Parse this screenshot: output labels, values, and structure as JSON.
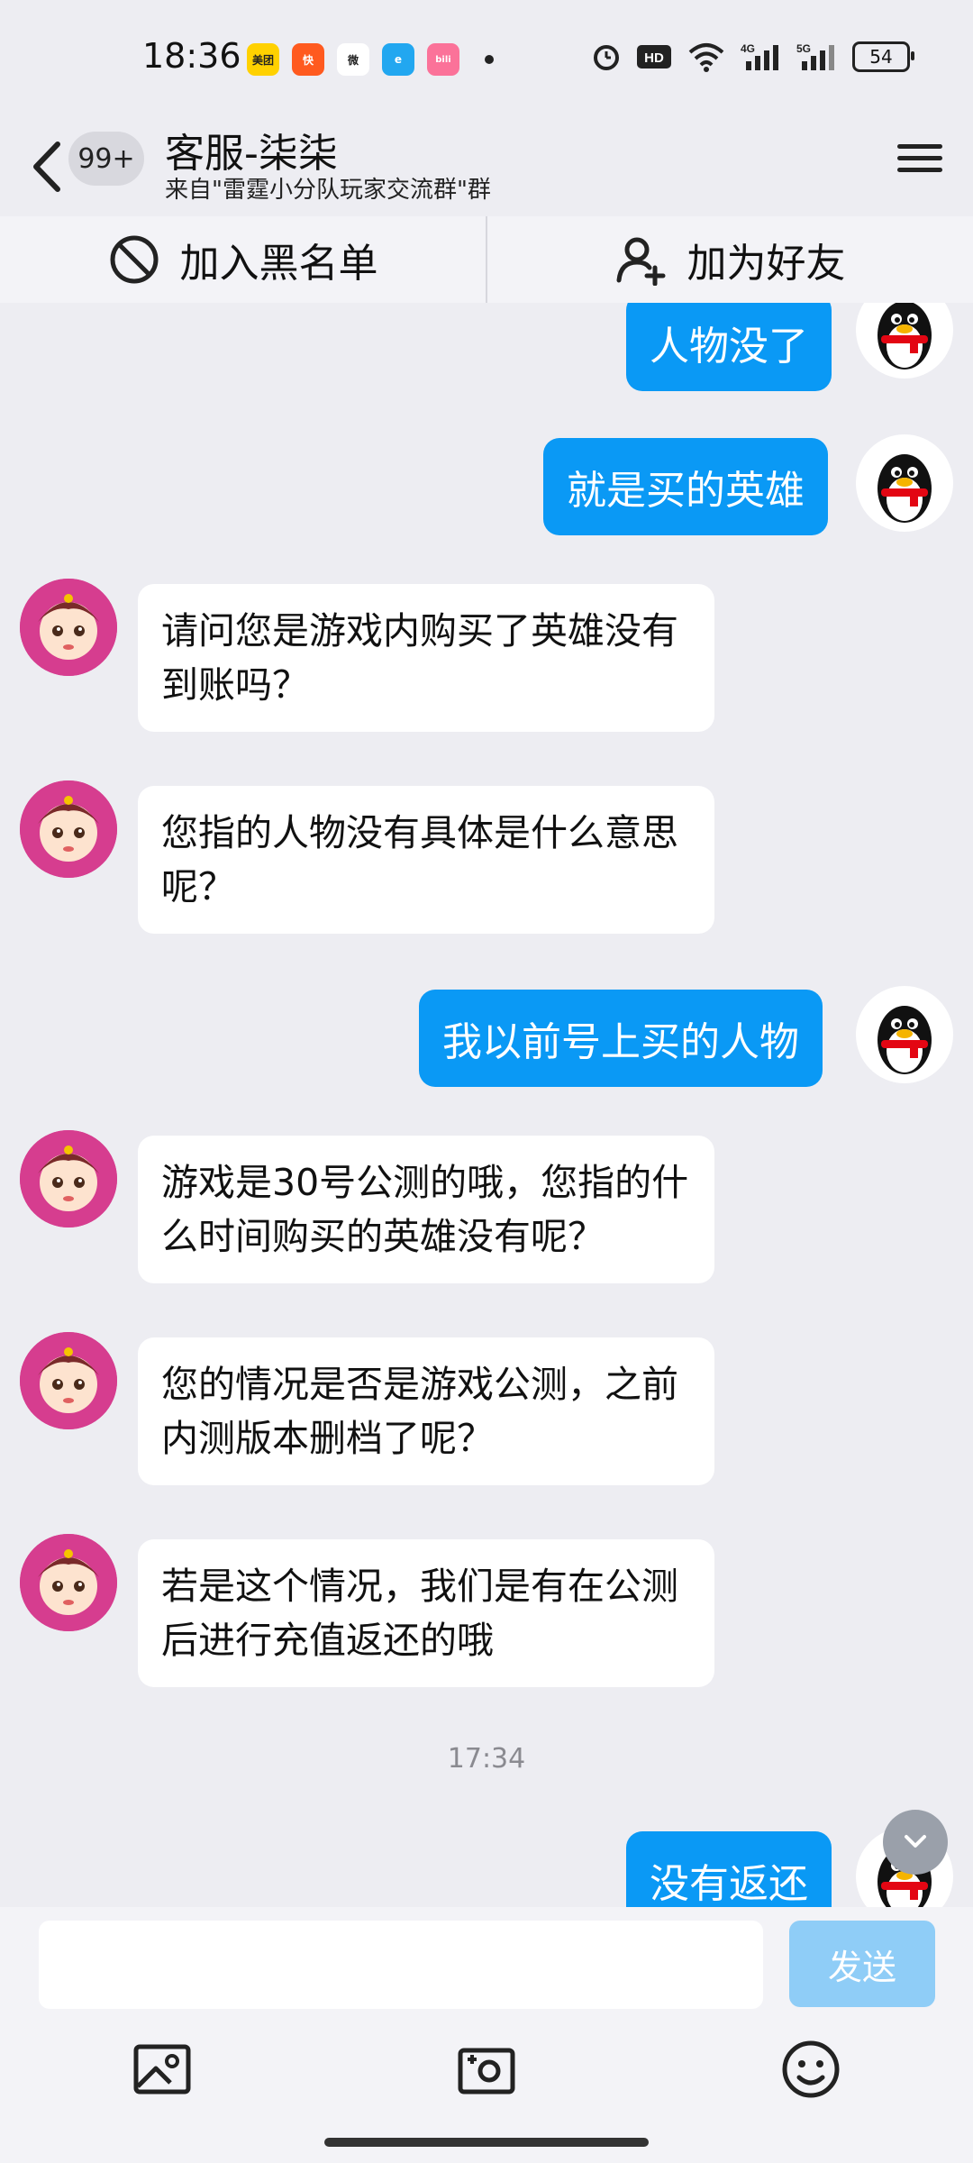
{
  "status_bar": {
    "time": "18:36",
    "apps": [
      {
        "name": "meituan-icon",
        "label": "美团",
        "color": "#ffd100",
        "text_color": "#222"
      },
      {
        "name": "kuaishou-icon",
        "label": "快",
        "color": "#ff5a1f",
        "text_color": "#fff"
      },
      {
        "name": "wechat-icon",
        "label": "微",
        "color": "#ffffff",
        "text_color": "#222"
      },
      {
        "name": "browser-icon",
        "label": "e",
        "color": "#22a7f0",
        "text_color": "#fff"
      },
      {
        "name": "bilibili-icon",
        "label": "bili",
        "color": "#fb7299",
        "text_color": "#fff"
      }
    ],
    "battery": "54"
  },
  "header": {
    "unread_count": "99+",
    "title": "客服-柒柒",
    "subtitle": "来自\"雷霆小分队玩家交流群\"群"
  },
  "actions": {
    "blacklist_label": "加入黑名单",
    "add_friend_label": "加为好友"
  },
  "messages": [
    {
      "side": "out",
      "text": "人物没了"
    },
    {
      "side": "out",
      "text": "就是买的英雄"
    },
    {
      "side": "in",
      "text": "请问您是游戏内购买了英雄没有到账吗？"
    },
    {
      "side": "in",
      "text": "您指的人物没有具体是什么意思呢？"
    },
    {
      "side": "out",
      "text": "我以前号上买的人物"
    },
    {
      "side": "in",
      "text": "游戏是30号公测的哦，您指的什么时间购买的英雄没有呢？"
    },
    {
      "side": "in",
      "text": "您的情况是否是游戏公测，之前内测版本删档了呢？"
    },
    {
      "side": "in",
      "text": "若是这个情况，我们是有在公测后进行充值返还的哦"
    },
    {
      "side": "out",
      "text": "没有返还"
    }
  ],
  "timestamp": "17:34",
  "input": {
    "value": "",
    "placeholder": "",
    "send_label": "发送"
  },
  "colors": {
    "outgoing_bubble": "#0a99f5",
    "incoming_bubble": "#ffffff",
    "background": "#ededf2",
    "send_disabled": "#8fcdf7"
  }
}
